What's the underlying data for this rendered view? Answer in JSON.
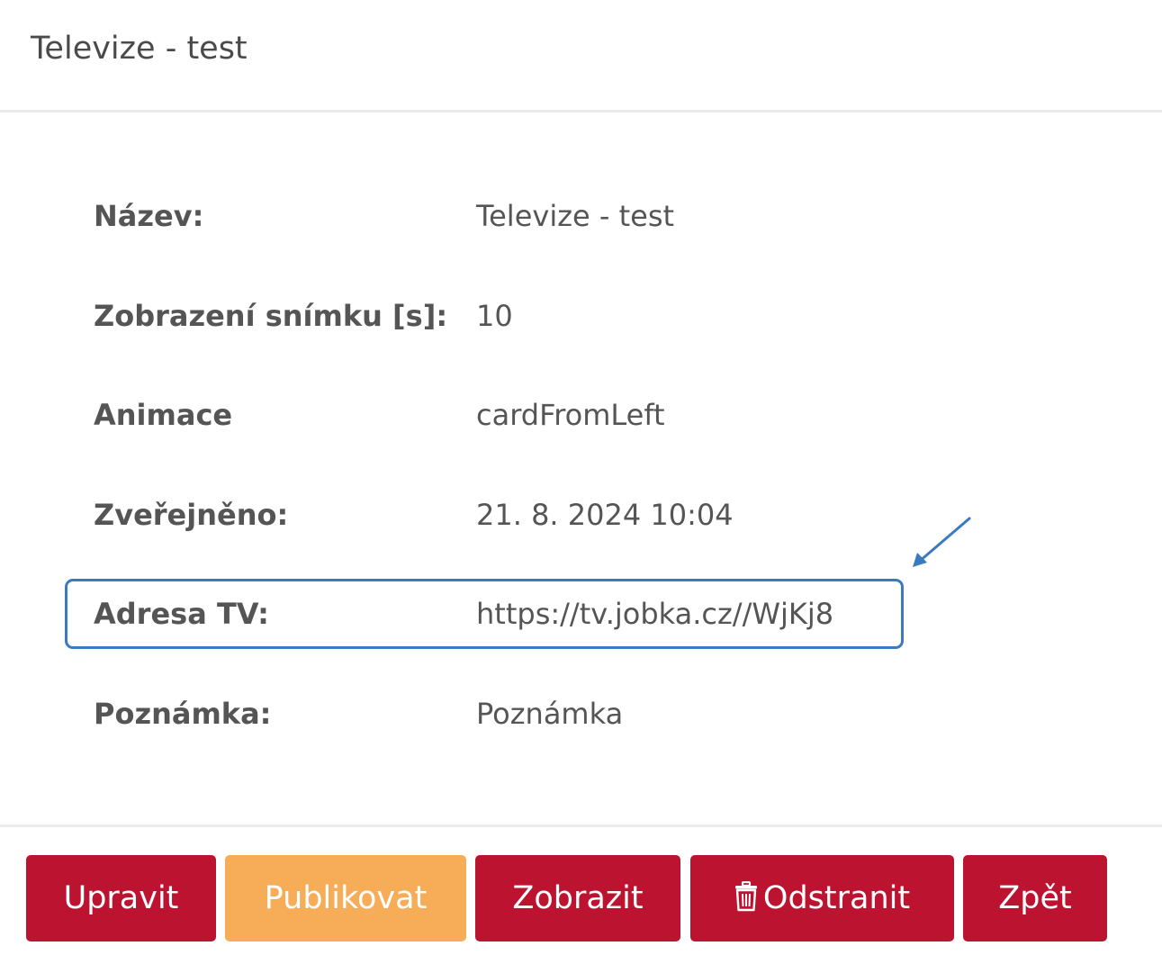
{
  "header": {
    "title": "Televize - test"
  },
  "details": {
    "rows": [
      {
        "label": "Název:",
        "value": "Televize - test"
      },
      {
        "label": "Zobrazení snímku [s]:",
        "value": "10"
      },
      {
        "label": "Animace",
        "value": "cardFromLeft"
      },
      {
        "label": "Zveřejněno:",
        "value": "21. 8. 2024 10:04"
      },
      {
        "label": "Adresa TV:",
        "value": "https://tv.jobka.cz//WjKj8"
      },
      {
        "label": "Poznámka:",
        "value": "Poznámka"
      }
    ]
  },
  "actions": {
    "edit": "Upravit",
    "publish": "Publikovat",
    "show": "Zobrazit",
    "delete": "Odstranit",
    "back": "Zpět"
  },
  "icons": {
    "delete": "trash-icon",
    "annotation": "arrow-icon"
  },
  "colors": {
    "primary": "#bc1331",
    "publish": "#f7ad57",
    "highlight": "#3a7bbf",
    "text": "#555555"
  }
}
